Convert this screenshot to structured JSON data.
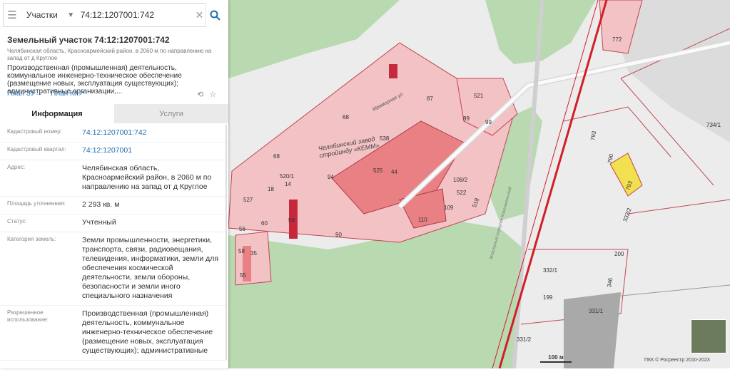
{
  "search": {
    "layer": "Участки",
    "value": "74:12:1207001:742",
    "menu_icon": "hamburger-icon",
    "search_icon": "search-icon"
  },
  "parcel": {
    "title": "Земельный участок 74:12:1207001:742",
    "address_short": "Челябинская область, Красноармейский район, в 2060 м по направлению на запад от д Круглое",
    "purpose_preview": "Производственная (промышленная) деятельность, коммунальное инженерно-техническое обеспечение (размещение новых, эксплуатация существующих); административные организации,...",
    "plan_zu": "План ЗУ",
    "plan_kk": "План КК"
  },
  "tabs": [
    "Информация",
    "Услуги"
  ],
  "rows": [
    {
      "label": "Кадастровый номер:",
      "value": "74:12:1207001:742",
      "link": true
    },
    {
      "label": "Кадастровый квартал:",
      "value": "74:12:1207001",
      "link": true
    },
    {
      "label": "Адрес:",
      "value": "Челябинская область, Красноармейский район, в 2060 м по направлению на запад от д Круглое",
      "link": false
    },
    {
      "label": "Площадь уточненная:",
      "value": "2 293 кв. м",
      "link": false
    },
    {
      "label": "Статус:",
      "value": "Учтенный",
      "link": false
    },
    {
      "label": "Категория земель:",
      "value": "Земли промышленности, энергетики, транспорта, связи, радиовещания, телевидения, информатики, земли для обеспечения космической деятельности, земли обороны, безопасности и земли иного специального назначения",
      "link": false
    },
    {
      "label": "Разрешенное использование:",
      "value": "Производственная (промышленная) деятельность, коммунальное инженерно-техническое обеспечение (размещение новых, эксплуатация существующих); административные",
      "link": false
    }
  ],
  "map": {
    "labels": [
      "68",
      "68",
      "538",
      "525",
      "44",
      "94",
      "520/1",
      "14",
      "18",
      "527",
      "56",
      "60",
      "59",
      "58",
      "35",
      "55",
      "90",
      "110",
      "109",
      "522",
      "518",
      "108/2",
      "87",
      "89",
      "99",
      "521",
      "772",
      "734/1",
      "793",
      "790",
      "793",
      "332/2",
      "200",
      "332/1",
      "346",
      "199",
      "331/1",
      "331/2"
    ],
    "factory_label": "Челябинский завод стройинду «КЕММ»",
    "street_label": "Мраморная ул",
    "road_label": "Межгорный переулок Комсомольской",
    "scale": "100 м",
    "copyright": "ПКК © Росреестр 2010-2023",
    "colors": {
      "green": "#b9d9b0",
      "pink": "#f2c2c4",
      "red": "#e88084",
      "dark_red": "#c6283c",
      "yellow": "#f1e04f",
      "railway": "#d21e26",
      "bg": "#ededed"
    }
  }
}
